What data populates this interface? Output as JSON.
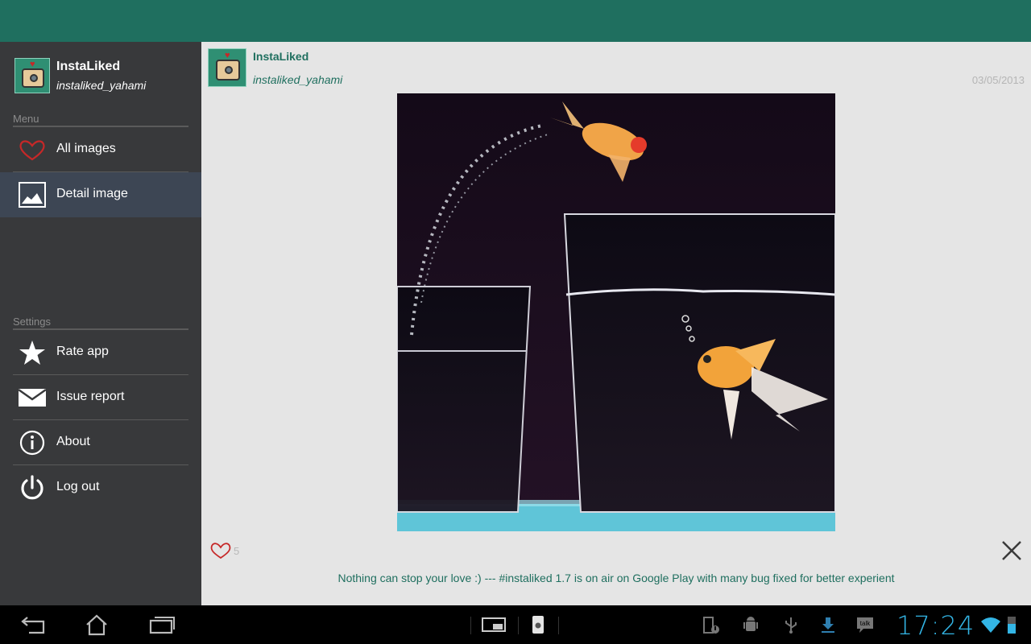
{
  "sidebar": {
    "profile": {
      "name": "InstaLiked",
      "username": "instaliked_yahami"
    },
    "menu_title": "Menu",
    "menu_items": [
      {
        "label": "All images",
        "icon": "heart-icon"
      },
      {
        "label": "Detail image",
        "icon": "image-icon"
      }
    ],
    "settings_title": "Settings",
    "settings_items": [
      {
        "label": "Rate app",
        "icon": "star-icon"
      },
      {
        "label": "Issue report",
        "icon": "mail-icon"
      },
      {
        "label": "About",
        "icon": "info-icon"
      },
      {
        "label": "Log out",
        "icon": "power-icon"
      }
    ]
  },
  "post": {
    "name": "InstaLiked",
    "username": "instaliked_yahami",
    "date": "03/05/2013",
    "likes": "5",
    "caption": "Nothing can stop your love :) --- #instaliked 1.7 is on air on Google Play with many bug fixed for better experient"
  },
  "statusbar": {
    "time": "17:24"
  },
  "colors": {
    "accent": "#1f6f5f",
    "sidebar": "#38393b",
    "selected": "#3d4654",
    "clock": "#33b5e5"
  }
}
